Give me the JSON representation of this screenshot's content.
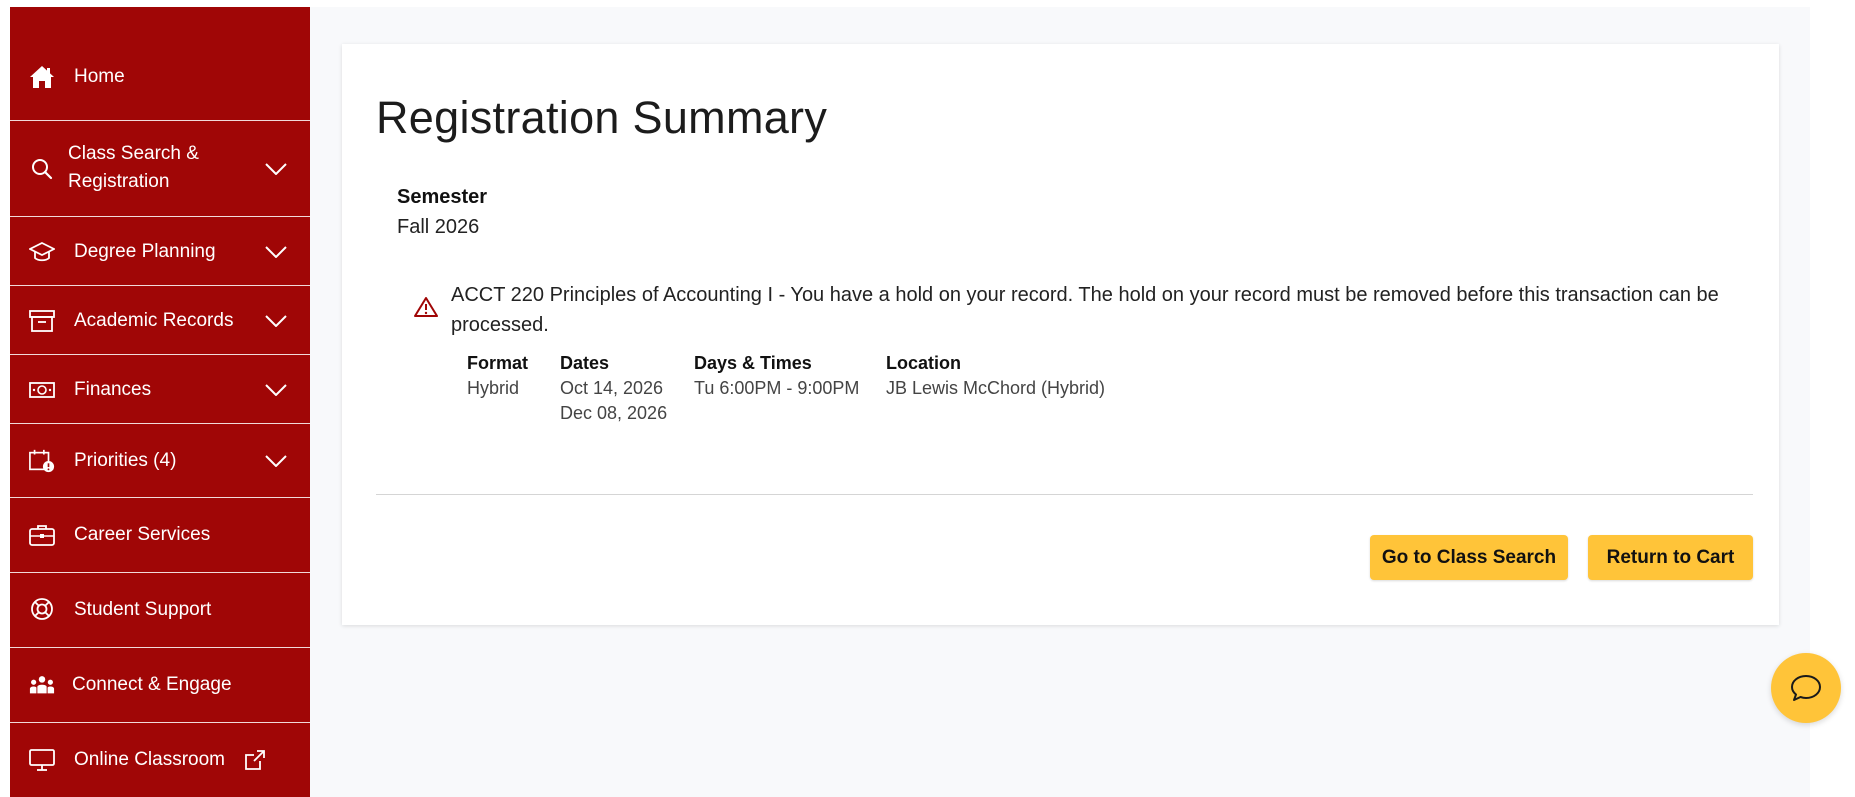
{
  "sidebar": {
    "items": [
      {
        "label": "Home",
        "icon": "home-icon"
      },
      {
        "label": "Class Search & Registration",
        "icon": "search-icon"
      },
      {
        "label": "Degree Planning",
        "icon": "graduation-cap-icon"
      },
      {
        "label": "Academic Records",
        "icon": "archive-box-icon"
      },
      {
        "label": "Finances",
        "icon": "money-bill-icon"
      },
      {
        "label": "Priorities (4)",
        "icon": "calendar-alert-icon"
      },
      {
        "label": "Career Services",
        "icon": "briefcase-icon"
      },
      {
        "label": "Student Support",
        "icon": "lifebuoy-icon"
      },
      {
        "label": "Connect & Engage",
        "icon": "people-group-icon"
      },
      {
        "label": "Online Classroom",
        "icon": "monitor-icon"
      }
    ]
  },
  "main": {
    "title": "Registration Summary",
    "semester_label": "Semester",
    "semester_value": "Fall 2026",
    "alert_message": "ACCT 220 Principles of Accounting I - You have a hold on your record. The hold on your record must be removed before this transaction can be processed.",
    "details": {
      "format_label": "Format",
      "format_value": "Hybrid",
      "dates_label": "Dates",
      "date_start": "Oct 14, 2026",
      "date_end": "Dec 08, 2026",
      "days_label": "Days & Times",
      "days_value": "Tu 6:00PM - 9:00PM",
      "location_label": "Location",
      "location_value": "JB Lewis McChord (Hybrid)"
    },
    "buttons": {
      "class_search": "Go to Class Search",
      "return_cart": "Return to Cart"
    }
  },
  "colors": {
    "sidebar_bg": "#a00606",
    "accent_button": "#ffc439",
    "alert_icon": "#a00606"
  }
}
